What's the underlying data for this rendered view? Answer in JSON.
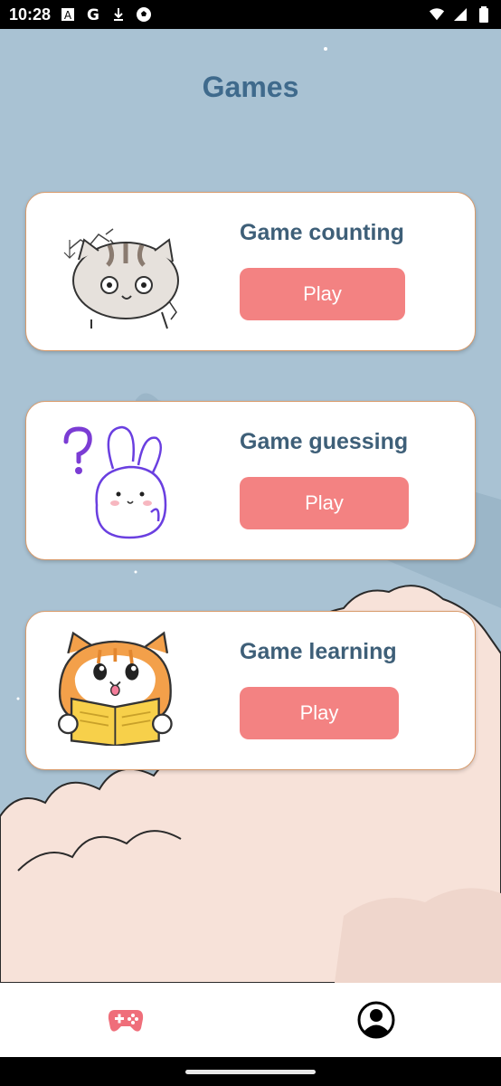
{
  "status_bar": {
    "time": "10:28",
    "left_icons": [
      "text-a-icon",
      "google-icon",
      "download-icon",
      "soccer-ball-icon"
    ],
    "right_icons": [
      "wifi-icon",
      "signal-icon",
      "battery-icon"
    ]
  },
  "page": {
    "title": "Games"
  },
  "games": [
    {
      "title": "Game counting",
      "play_label": "Play",
      "art": "thinking-cat-icon"
    },
    {
      "title": "Game guessing",
      "play_label": "Play",
      "art": "question-bunny-icon"
    },
    {
      "title": "Game learning",
      "play_label": "Play",
      "art": "reading-cat-icon"
    }
  ],
  "bottom_nav": {
    "items": [
      {
        "icon": "gamepad-icon",
        "active": true
      },
      {
        "icon": "profile-icon",
        "active": false
      }
    ]
  },
  "colors": {
    "background": "#a9c2d3",
    "clouds": "#f7e2d9",
    "title": "#3f6a8c",
    "card_border": "#d89a6a",
    "play_button": "#f38282",
    "nav_active": "#ef6e7a"
  }
}
